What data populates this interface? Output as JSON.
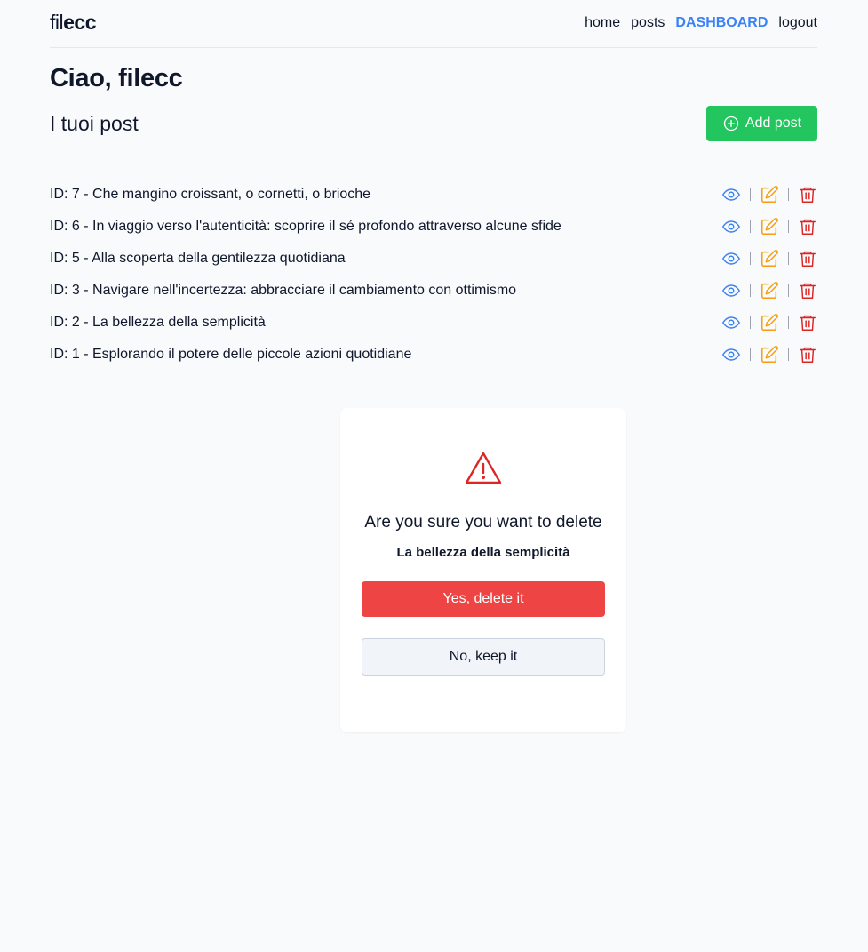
{
  "brand": {
    "light": "fil",
    "bold": "ecc"
  },
  "nav": {
    "home": "home",
    "posts": "posts",
    "dashboard": "DASHBOARD",
    "logout": "logout"
  },
  "greeting": "Ciao, filecc",
  "section_title": "I tuoi post",
  "add_button": {
    "label": "Add post",
    "icon": "plus-circle-icon"
  },
  "posts": [
    {
      "label": "ID: 7 - Che mangino croissant, o cornetti, o brioche"
    },
    {
      "label": "ID: 6 - In viaggio verso l'autenticità: scoprire il sé profondo attraverso alcune sfide"
    },
    {
      "label": "ID: 5 - Alla scoperta della gentilezza quotidiana"
    },
    {
      "label": "ID: 3 - Navigare nell'incertezza: abbracciare il cambiamento con ottimismo"
    },
    {
      "label": "ID: 2 - La bellezza della semplicità"
    },
    {
      "label": "ID: 1 - Esplorando il potere delle piccole azioni quotidiane"
    }
  ],
  "row_actions": {
    "view_icon": "eye-icon",
    "edit_icon": "pencil-square-icon",
    "delete_icon": "trash-icon"
  },
  "modal": {
    "icon": "warning-triangle-icon",
    "question": "Are you sure you want to delete",
    "post_title": "La bellezza della semplicità",
    "confirm_label": "Yes, delete it",
    "cancel_label": "No, keep it"
  },
  "colors": {
    "background": "#f8fafc",
    "accent_blue": "#3b82f6",
    "add_green": "#22c55e",
    "edit_orange": "#f59e0b",
    "danger_red": "#ef4444",
    "warning_red": "#dc2626"
  }
}
